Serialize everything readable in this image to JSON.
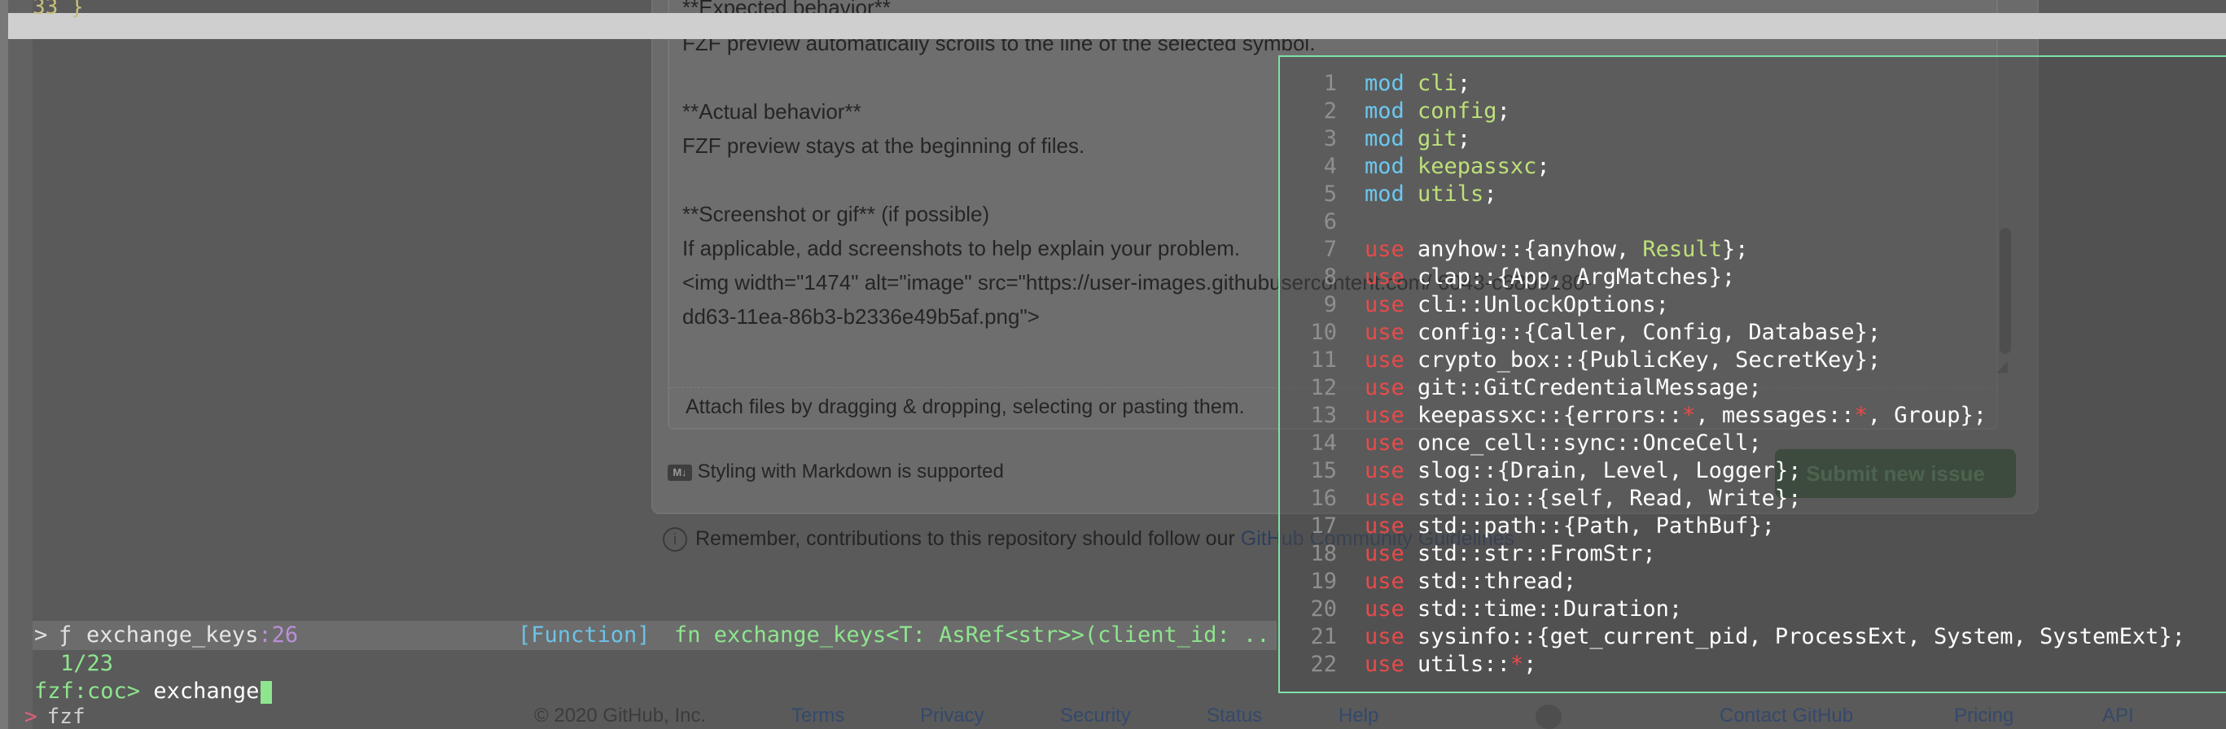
{
  "editor_top_line": "33 }",
  "github_page": {
    "body_lines": [
      "**Expected behavior**",
      "FZF preview automatically scrolls to the line of the selected symbol.",
      "",
      "**Actual behavior**",
      "FZF preview stays at the beginning of files.",
      "",
      "**Screenshot or gif** (if possible)",
      "If applicable, add screenshots to help explain your problem.",
      "<img width=\"1474\" alt=\"image\" src=\"https://user-images.githubusercontent.com/                     6043-c6800180-",
      "dd63-11ea-86b3-b2336e49b5af.png\">"
    ],
    "attach_hint": "Attach files by dragging & dropping, selecting or pasting them.",
    "markdown_note": "Styling with Markdown is supported",
    "submit_label": "Submit new issue",
    "contrib_note_prefix": "Remember, contributions to this repository should follow our ",
    "contrib_link": "GitHub Community Guidelines",
    "footer": {
      "copyright": "© 2020 GitHub, Inc.",
      "links": [
        "Terms",
        "Privacy",
        "Security",
        "Status",
        "Help",
        "Contact GitHub",
        "Pricing",
        "API"
      ]
    }
  },
  "fzf": {
    "pointer": ">",
    "kind_icon": "ƒ",
    "item_name": "exchange_keys",
    "item_line": ":26",
    "item_type": "[Function]",
    "item_signature": "fn exchange_keys<T: AsRef<str>>(client_id: ..",
    "count": "1/23",
    "prompt": "fzf:coc> ",
    "query": "exchange"
  },
  "terminal_bottom": {
    "marker": ">",
    "text": "fzf"
  },
  "preview": {
    "lines": [
      {
        "n": "1",
        "tokens": [
          [
            "k-mod",
            "mod "
          ],
          [
            "ty",
            "cli"
          ],
          [
            "id",
            ";"
          ]
        ]
      },
      {
        "n": "2",
        "tokens": [
          [
            "k-mod",
            "mod "
          ],
          [
            "ty",
            "config"
          ],
          [
            "id",
            ";"
          ]
        ]
      },
      {
        "n": "3",
        "tokens": [
          [
            "k-mod",
            "mod "
          ],
          [
            "ty",
            "git"
          ],
          [
            "id",
            ";"
          ]
        ]
      },
      {
        "n": "4",
        "tokens": [
          [
            "k-mod",
            "mod "
          ],
          [
            "ty",
            "keepassxc"
          ],
          [
            "id",
            ";"
          ]
        ]
      },
      {
        "n": "5",
        "tokens": [
          [
            "k-mod",
            "mod "
          ],
          [
            "ty",
            "utils"
          ],
          [
            "id",
            ";"
          ]
        ]
      },
      {
        "n": "6",
        "tokens": []
      },
      {
        "n": "7",
        "tokens": [
          [
            "k-use",
            "use "
          ],
          [
            "id",
            "anyhow::{anyhow, "
          ],
          [
            "ty",
            "Result"
          ],
          [
            "id",
            "};"
          ]
        ]
      },
      {
        "n": "8",
        "tokens": [
          [
            "k-use",
            "use "
          ],
          [
            "id",
            "clap::{App, ArgMatches};"
          ]
        ]
      },
      {
        "n": "9",
        "tokens": [
          [
            "k-use",
            "use "
          ],
          [
            "id",
            "cli::UnlockOptions;"
          ]
        ]
      },
      {
        "n": "10",
        "tokens": [
          [
            "k-use",
            "use "
          ],
          [
            "id",
            "config::{Caller, Config, Database};"
          ]
        ]
      },
      {
        "n": "11",
        "tokens": [
          [
            "k-use",
            "use "
          ],
          [
            "id",
            "crypto_box::{PublicKey, SecretKey};"
          ]
        ]
      },
      {
        "n": "12",
        "tokens": [
          [
            "k-use",
            "use "
          ],
          [
            "id",
            "git::GitCredentialMessage;"
          ]
        ]
      },
      {
        "n": "13",
        "tokens": [
          [
            "k-use",
            "use "
          ],
          [
            "id",
            "keepassxc::{errors::"
          ],
          [
            "star",
            "*"
          ],
          [
            "id",
            ", messages::"
          ],
          [
            "star",
            "*"
          ],
          [
            "id",
            ", Group};"
          ]
        ]
      },
      {
        "n": "14",
        "tokens": [
          [
            "k-use",
            "use "
          ],
          [
            "id",
            "once_cell::sync::OnceCell;"
          ]
        ]
      },
      {
        "n": "15",
        "tokens": [
          [
            "k-use",
            "use "
          ],
          [
            "id",
            "slog::{Drain, Level, Logger};"
          ]
        ]
      },
      {
        "n": "16",
        "tokens": [
          [
            "k-use",
            "use "
          ],
          [
            "id",
            "std::io::{self, Read, Write};"
          ]
        ]
      },
      {
        "n": "17",
        "tokens": [
          [
            "k-use",
            "use "
          ],
          [
            "id",
            "std::path::{Path, PathBuf};"
          ]
        ]
      },
      {
        "n": "18",
        "tokens": [
          [
            "k-use",
            "use "
          ],
          [
            "id",
            "std::str::FromStr;"
          ]
        ]
      },
      {
        "n": "19",
        "tokens": [
          [
            "k-use",
            "use "
          ],
          [
            "id",
            "std::thread;"
          ]
        ]
      },
      {
        "n": "20",
        "tokens": [
          [
            "k-use",
            "use "
          ],
          [
            "id",
            "std::time::Duration;"
          ]
        ]
      },
      {
        "n": "21",
        "tokens": [
          [
            "k-use",
            "use "
          ],
          [
            "id",
            "sysinfo::{get_current_pid, ProcessExt, System, SystemExt};"
          ]
        ]
      },
      {
        "n": "22",
        "tokens": [
          [
            "k-use",
            "use "
          ],
          [
            "id",
            "utils::"
          ],
          [
            "star",
            "*"
          ],
          [
            "id",
            ";"
          ]
        ]
      }
    ]
  }
}
